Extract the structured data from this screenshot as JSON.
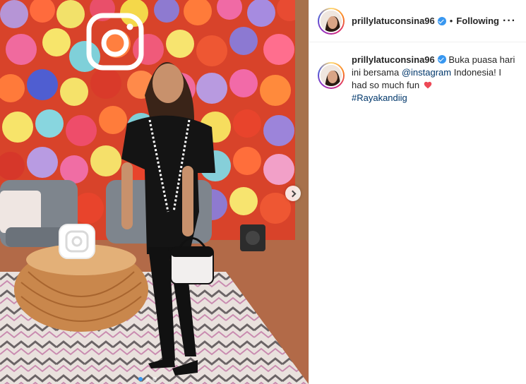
{
  "post": {
    "username": "prillylatuconsina96",
    "verified": true,
    "separator": "•",
    "follow_status": "Following",
    "more_icon": "···"
  },
  "caption": {
    "username": "prillylatuconsina96",
    "text_1": "Buka puasa hari ini bersama",
    "mention": "@instagram",
    "text_2": "Indonesia! I had so much fun",
    "hashtag": "#Rayakandiig"
  },
  "media": {
    "carousel_slides": 3,
    "active_slide": 1
  },
  "colors": {
    "verified": "#3897f0",
    "link": "#00376b",
    "heart": "#ed4956",
    "active_dot": "#3897f0"
  }
}
